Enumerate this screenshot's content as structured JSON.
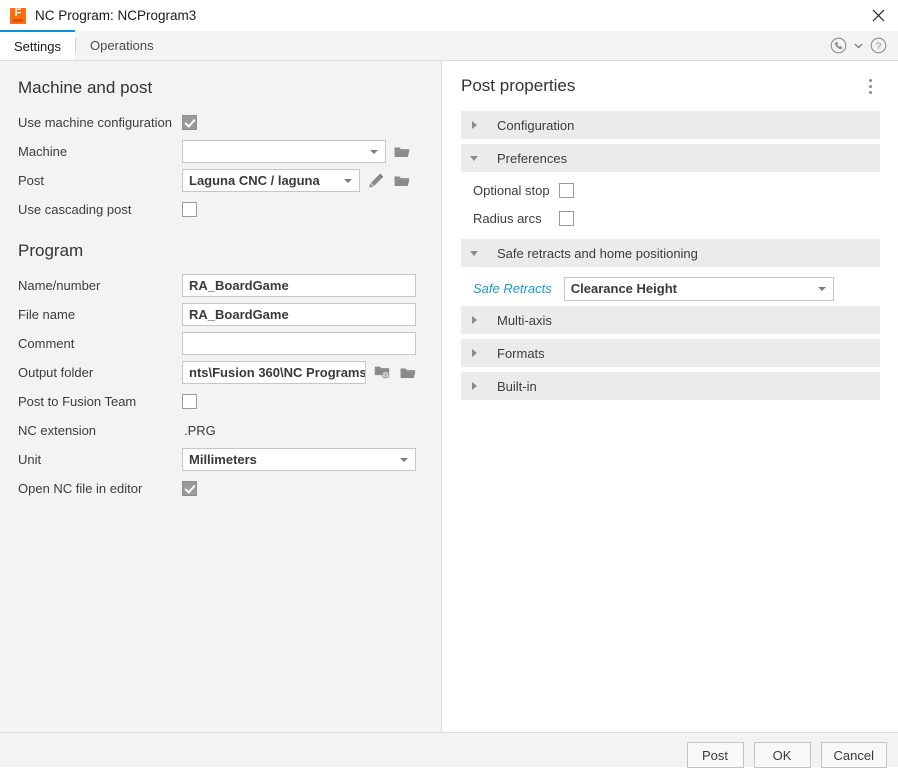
{
  "window": {
    "title": "NC Program: NCProgram3",
    "logo_icon": "fusion-logo-icon",
    "close_icon": "close-icon"
  },
  "tabs": [
    {
      "label": "Settings",
      "active": true
    },
    {
      "label": "Operations",
      "active": false
    }
  ],
  "tabbar_icons": {
    "support_icon": "phone-support-icon",
    "chevron_icon": "chevron-down-icon",
    "help_icon": "help-question-icon"
  },
  "left_panel": {
    "machine_and_post": {
      "title": "Machine and post",
      "rows": [
        {
          "label": "Use machine configuration",
          "type": "checkbox",
          "checked": true,
          "name": "use-machine-configuration"
        },
        {
          "label": "Machine",
          "type": "combo",
          "value": "",
          "name": "machine",
          "trailing_icons": [
            "folder-open-icon"
          ]
        },
        {
          "label": "Post",
          "type": "combo",
          "value": "Laguna CNC / laguna",
          "name": "post",
          "trailing_icons": [
            "pencil-edit-icon",
            "folder-open-icon"
          ]
        },
        {
          "label": "Use cascading post",
          "type": "checkbox",
          "checked": false,
          "name": "use-cascading-post"
        }
      ]
    },
    "program": {
      "title": "Program",
      "rows": [
        {
          "label": "Name/number",
          "type": "text",
          "value": "RA_BoardGame",
          "name": "name-number"
        },
        {
          "label": "File name",
          "type": "text",
          "value": "RA_BoardGame",
          "name": "file-name"
        },
        {
          "label": "Comment",
          "type": "text",
          "value": "",
          "name": "comment"
        },
        {
          "label": "Output folder",
          "type": "text",
          "value": "nts\\Fusion 360\\NC Programs",
          "name": "output-folder",
          "trailing_icons": [
            "folder-preview-icon",
            "folder-open-icon"
          ]
        },
        {
          "label": "Post to Fusion Team",
          "type": "checkbox",
          "checked": false,
          "name": "post-to-fusion-team"
        },
        {
          "label": "NC extension",
          "type": "static",
          "value": ".PRG",
          "name": "nc-extension"
        },
        {
          "label": "Unit",
          "type": "combo",
          "value": "Millimeters",
          "name": "unit"
        },
        {
          "label": "Open NC file in editor",
          "type": "checkbox",
          "checked": true,
          "name": "open-nc-file-in-editor"
        }
      ]
    }
  },
  "right_panel": {
    "title": "Post properties",
    "overflow_menu_icon": "more-vertical-icon",
    "groups": [
      {
        "label": "Configuration",
        "expanded": false,
        "name": "configuration",
        "items": []
      },
      {
        "label": "Preferences",
        "expanded": true,
        "name": "preferences",
        "items": [
          {
            "label": "Optional stop",
            "type": "checkbox",
            "checked": false,
            "name": "optional-stop"
          },
          {
            "label": "Radius arcs",
            "type": "checkbox",
            "checked": false,
            "name": "radius-arcs"
          }
        ]
      },
      {
        "label": "Safe retracts and home positioning",
        "expanded": true,
        "name": "safe-retracts-and-home-positioning",
        "items": [
          {
            "label": "Safe Retracts",
            "type": "combo",
            "value": "Clearance Height",
            "link": true,
            "name": "safe-retracts"
          }
        ]
      },
      {
        "label": "Multi-axis",
        "expanded": false,
        "name": "multi-axis",
        "items": []
      },
      {
        "label": "Formats",
        "expanded": false,
        "name": "formats",
        "items": []
      },
      {
        "label": "Built-in",
        "expanded": false,
        "name": "built-in",
        "items": []
      }
    ]
  },
  "footer": {
    "buttons": [
      {
        "label": "Post",
        "name": "post-button"
      },
      {
        "label": "OK",
        "name": "ok-button"
      },
      {
        "label": "Cancel",
        "name": "cancel-button"
      }
    ]
  },
  "colors": {
    "accent": "#0696d7",
    "link": "#1a9ad7",
    "logo": "#ff6c0c",
    "panel_bg": "#f3f3f3",
    "group_bg": "#ebebeb"
  }
}
